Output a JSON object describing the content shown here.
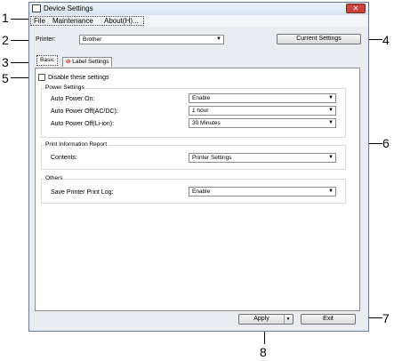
{
  "window": {
    "title": "Device Settings",
    "close_label": "✕"
  },
  "menu": {
    "file": "File",
    "maintenance": "Maintenance",
    "about": "About(H)..."
  },
  "printer": {
    "label": "Printer:",
    "value": "Brother"
  },
  "current_settings_label": "Current Settings",
  "tabs": [
    {
      "label": "Basic"
    },
    {
      "label": "Label Settings"
    }
  ],
  "disable_settings_label": "Disable these settings",
  "power_settings": {
    "title": "Power Settings",
    "auto_power_on": {
      "label": "Auto Power On:",
      "value": "Enable"
    },
    "auto_power_off_ac": {
      "label": "Auto Power Off(AC/DC):",
      "value": "1 hour"
    },
    "auto_power_off_li": {
      "label": "Auto Power Off(Li-ion):",
      "value": "30 Minutes"
    }
  },
  "print_info": {
    "title": "Print Information Report",
    "contents": {
      "label": "Contents:",
      "value": "Printer Settings"
    }
  },
  "others": {
    "title": "Others",
    "save_log": {
      "label": "Save Printer Print Log:",
      "value": "Enable"
    }
  },
  "apply_label": "Apply",
  "exit_label": "Exit",
  "callouts": [
    "1",
    "2",
    "3",
    "4",
    "5",
    "6",
    "7",
    "8"
  ]
}
